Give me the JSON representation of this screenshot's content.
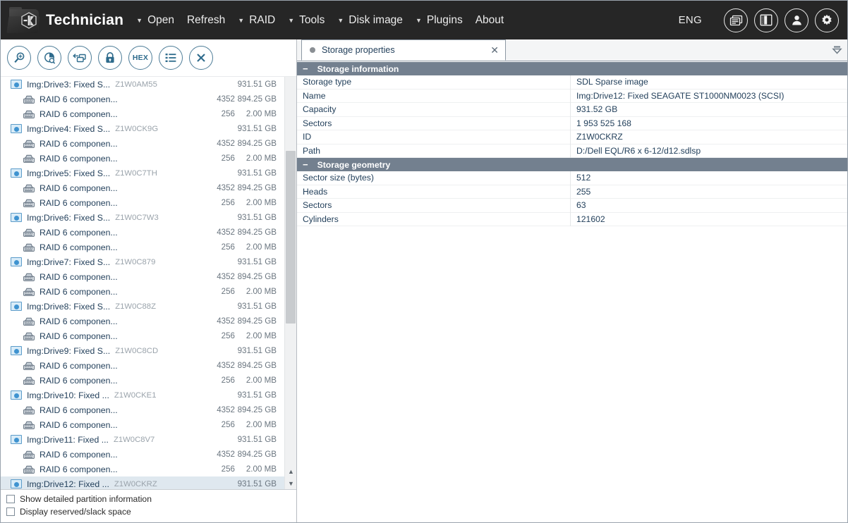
{
  "header": {
    "app_title": "Technician",
    "logo_icon": "technician-folder-logo",
    "menus": [
      {
        "label": "Open",
        "caret": true
      },
      {
        "label": "Refresh",
        "caret": false
      },
      {
        "label": "RAID",
        "caret": true
      },
      {
        "label": "Tools",
        "caret": true
      },
      {
        "label": "Disk image",
        "caret": true
      },
      {
        "label": "Plugins",
        "caret": true
      },
      {
        "label": "About",
        "caret": false
      }
    ],
    "language": "ENG",
    "icons": [
      "windows-icon",
      "panel-layout-icon",
      "user-icon",
      "gear-icon"
    ]
  },
  "toolbar": {
    "buttons": [
      {
        "name": "find-icon",
        "glyph": "search"
      },
      {
        "name": "disk-analysis-icon",
        "glyph": "pie"
      },
      {
        "name": "clone-icon",
        "glyph": "clone"
      },
      {
        "name": "lock-icon",
        "glyph": "lock"
      },
      {
        "name": "hex-viewer-icon",
        "glyph": "HEX"
      },
      {
        "name": "list-icon",
        "glyph": "list"
      },
      {
        "name": "close-icon",
        "glyph": "x"
      }
    ]
  },
  "tree": {
    "rows": [
      {
        "type": "drive",
        "label": "Img:Drive3: Fixed S...",
        "serial": "Z1W0AM55",
        "count": "",
        "size": "931.51 GB",
        "selected": false
      },
      {
        "type": "raid",
        "label": "RAID 6 componen...",
        "serial": "",
        "count": "4352",
        "size": "894.25 GB",
        "selected": false
      },
      {
        "type": "raid",
        "label": "RAID 6 componen...",
        "serial": "",
        "count": "256",
        "size": "2.00 MB",
        "selected": false
      },
      {
        "type": "drive",
        "label": "Img:Drive4: Fixed S...",
        "serial": "Z1W0CK9G",
        "count": "",
        "size": "931.51 GB",
        "selected": false
      },
      {
        "type": "raid",
        "label": "RAID 6 componen...",
        "serial": "",
        "count": "4352",
        "size": "894.25 GB",
        "selected": false
      },
      {
        "type": "raid",
        "label": "RAID 6 componen...",
        "serial": "",
        "count": "256",
        "size": "2.00 MB",
        "selected": false
      },
      {
        "type": "drive",
        "label": "Img:Drive5: Fixed S...",
        "serial": "Z1W0C7TH",
        "count": "",
        "size": "931.51 GB",
        "selected": false
      },
      {
        "type": "raid",
        "label": "RAID 6 componen...",
        "serial": "",
        "count": "4352",
        "size": "894.25 GB",
        "selected": false
      },
      {
        "type": "raid",
        "label": "RAID 6 componen...",
        "serial": "",
        "count": "256",
        "size": "2.00 MB",
        "selected": false
      },
      {
        "type": "drive",
        "label": "Img:Drive6: Fixed S...",
        "serial": "Z1W0C7W3",
        "count": "",
        "size": "931.51 GB",
        "selected": false
      },
      {
        "type": "raid",
        "label": "RAID 6 componen...",
        "serial": "",
        "count": "4352",
        "size": "894.25 GB",
        "selected": false
      },
      {
        "type": "raid",
        "label": "RAID 6 componen...",
        "serial": "",
        "count": "256",
        "size": "2.00 MB",
        "selected": false
      },
      {
        "type": "drive",
        "label": "Img:Drive7: Fixed S...",
        "serial": "Z1W0C879",
        "count": "",
        "size": "931.51 GB",
        "selected": false
      },
      {
        "type": "raid",
        "label": "RAID 6 componen...",
        "serial": "",
        "count": "4352",
        "size": "894.25 GB",
        "selected": false
      },
      {
        "type": "raid",
        "label": "RAID 6 componen...",
        "serial": "",
        "count": "256",
        "size": "2.00 MB",
        "selected": false
      },
      {
        "type": "drive",
        "label": "Img:Drive8: Fixed S...",
        "serial": "Z1W0C88Z",
        "count": "",
        "size": "931.51 GB",
        "selected": false
      },
      {
        "type": "raid",
        "label": "RAID 6 componen...",
        "serial": "",
        "count": "4352",
        "size": "894.25 GB",
        "selected": false
      },
      {
        "type": "raid",
        "label": "RAID 6 componen...",
        "serial": "",
        "count": "256",
        "size": "2.00 MB",
        "selected": false
      },
      {
        "type": "drive",
        "label": "Img:Drive9: Fixed S...",
        "serial": "Z1W0C8CD",
        "count": "",
        "size": "931.51 GB",
        "selected": false
      },
      {
        "type": "raid",
        "label": "RAID 6 componen...",
        "serial": "",
        "count": "4352",
        "size": "894.25 GB",
        "selected": false
      },
      {
        "type": "raid",
        "label": "RAID 6 componen...",
        "serial": "",
        "count": "256",
        "size": "2.00 MB",
        "selected": false
      },
      {
        "type": "drive",
        "label": "Img:Drive10: Fixed ...",
        "serial": "Z1W0CKE1",
        "count": "",
        "size": "931.51 GB",
        "selected": false
      },
      {
        "type": "raid",
        "label": "RAID 6 componen...",
        "serial": "",
        "count": "4352",
        "size": "894.25 GB",
        "selected": false
      },
      {
        "type": "raid",
        "label": "RAID 6 componen...",
        "serial": "",
        "count": "256",
        "size": "2.00 MB",
        "selected": false
      },
      {
        "type": "drive",
        "label": "Img:Drive11: Fixed ...",
        "serial": "Z1W0C8V7",
        "count": "",
        "size": "931.51 GB",
        "selected": false
      },
      {
        "type": "raid",
        "label": "RAID 6 componen...",
        "serial": "",
        "count": "4352",
        "size": "894.25 GB",
        "selected": false
      },
      {
        "type": "raid",
        "label": "RAID 6 componen...",
        "serial": "",
        "count": "256",
        "size": "2.00 MB",
        "selected": false
      },
      {
        "type": "drive",
        "label": "Img:Drive12: Fixed ...",
        "serial": "Z1W0CKRZ",
        "count": "",
        "size": "931.51 GB",
        "selected": true
      }
    ]
  },
  "left_footer": {
    "checkboxes": [
      {
        "label": "Show detailed partition information",
        "checked": false
      },
      {
        "label": "Display reserved/slack space",
        "checked": false
      }
    ]
  },
  "right": {
    "tab": {
      "label": "Storage properties",
      "close": "✕"
    },
    "collapse_icon": "collapse-panel-icon",
    "sections": [
      {
        "title": "Storage information",
        "rows": [
          {
            "key": "Storage type",
            "value": "SDL Sparse image"
          },
          {
            "key": "Name",
            "value": "Img:Drive12: Fixed SEAGATE ST1000NM0023 (SCSI)"
          },
          {
            "key": "Capacity",
            "value": "931.52 GB"
          },
          {
            "key": "Sectors",
            "value": "1 953 525 168"
          },
          {
            "key": "ID",
            "value": "Z1W0CKRZ"
          },
          {
            "key": "Path",
            "value": "D:/Dell EQL/R6 x 6-12/d12.sdlsp"
          }
        ]
      },
      {
        "title": "Storage geometry",
        "rows": [
          {
            "key": "Sector size (bytes)",
            "value": "512"
          },
          {
            "key": "Heads",
            "value": "255"
          },
          {
            "key": "Sectors",
            "value": "63"
          },
          {
            "key": "Cylinders",
            "value": "121602"
          }
        ]
      }
    ]
  },
  "colors": {
    "header_bg": "#262626",
    "accent_blue": "#2e6b8c",
    "section_header_bg": "#73808f",
    "text_blue": "#24415c",
    "selection_bg": "#dfe8ef"
  }
}
